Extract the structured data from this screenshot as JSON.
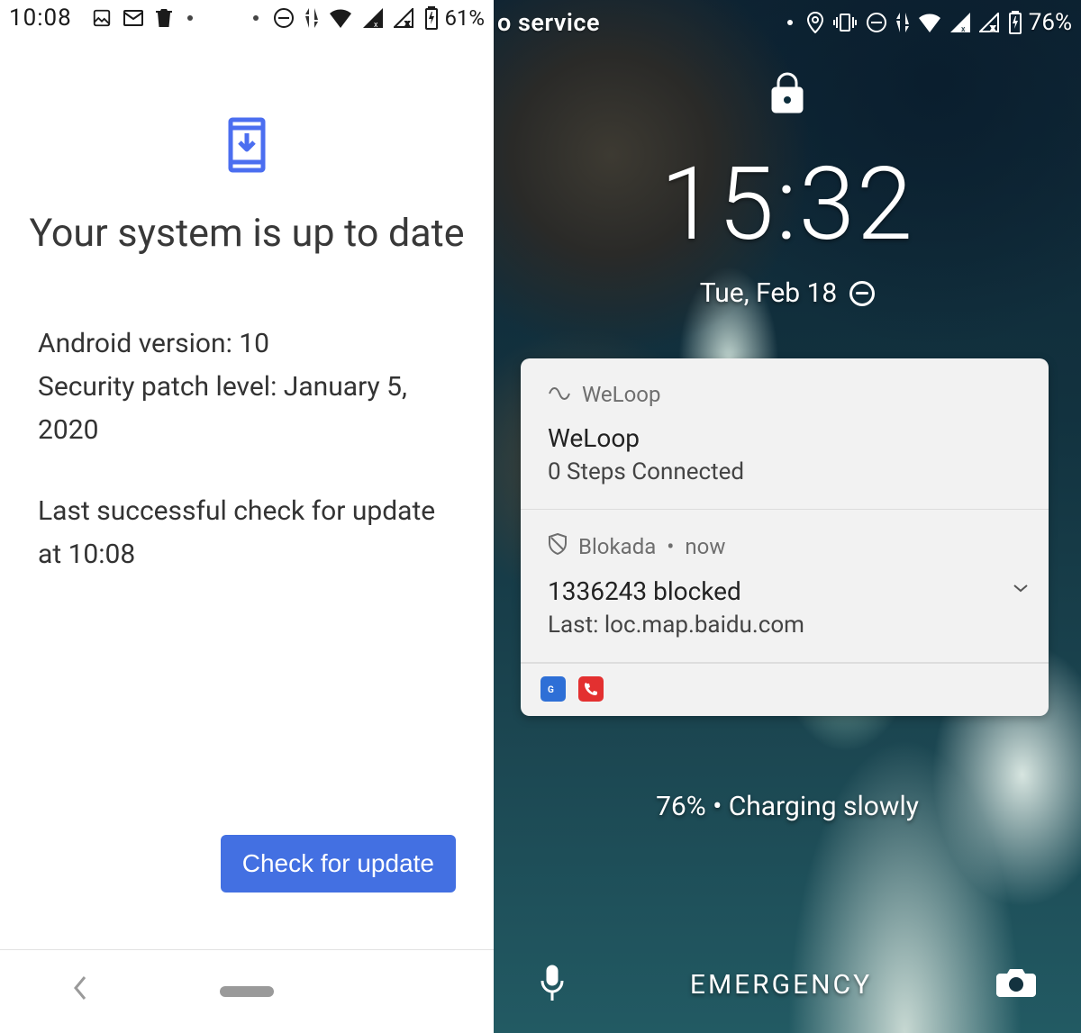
{
  "left": {
    "status": {
      "time": "10:08",
      "battery": "61%"
    },
    "title": "Your system is up to date",
    "version": "Android version: 10",
    "patch": "Security patch level: January 5, 2020",
    "last_check": "Last successful check for update at 10:08",
    "button": "Check for update"
  },
  "right": {
    "status": {
      "carrier": "o service",
      "battery": "76%"
    },
    "clock": "15:32",
    "date": "Tue, Feb 18",
    "notif1": {
      "app": "WeLoop",
      "title": "WeLoop",
      "sub": "0 Steps  Connected"
    },
    "notif2": {
      "app": "Blokada",
      "when": "now",
      "title": "1336243 blocked",
      "sub": "Last: loc.map.baidu.com"
    },
    "charge": "76% • Charging slowly",
    "emergency": "EMERGENCY"
  }
}
